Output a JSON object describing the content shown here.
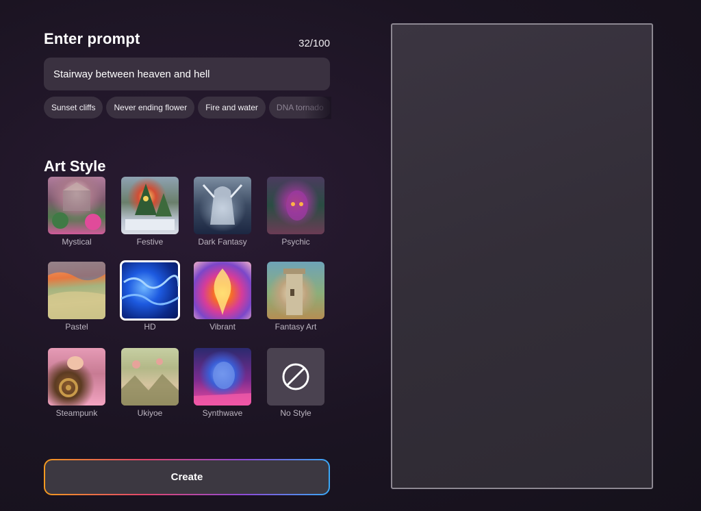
{
  "prompt": {
    "title": "Enter prompt",
    "counter": "32/100",
    "value": "Stairway between heaven and hell"
  },
  "suggestions": [
    "Sunset cliffs",
    "Never ending flower",
    "Fire and water",
    "DNA tornado"
  ],
  "art_style": {
    "title": "Art Style",
    "selected": "HD",
    "styles": [
      {
        "label": "Mystical",
        "icon": "art-thumbnail"
      },
      {
        "label": "Festive",
        "icon": "art-thumbnail"
      },
      {
        "label": "Dark Fantasy",
        "icon": "art-thumbnail"
      },
      {
        "label": "Psychic",
        "icon": "art-thumbnail"
      },
      {
        "label": "Pastel",
        "icon": "art-thumbnail"
      },
      {
        "label": "HD",
        "icon": "art-thumbnail"
      },
      {
        "label": "Vibrant",
        "icon": "art-thumbnail"
      },
      {
        "label": "Fantasy Art",
        "icon": "art-thumbnail"
      },
      {
        "label": "Steampunk",
        "icon": "art-thumbnail"
      },
      {
        "label": "Ukiyoe",
        "icon": "art-thumbnail"
      },
      {
        "label": "Synthwave",
        "icon": "art-thumbnail"
      },
      {
        "label": "No Style",
        "icon": "no-style-icon"
      }
    ]
  },
  "create_button": {
    "label": "Create"
  },
  "colors": {
    "background": "#1b1422",
    "field": "#3a3140",
    "selected_border": "#ffffff",
    "button_gradient": [
      "#f39a1f",
      "#e2466c",
      "#8e4bd8",
      "#3aa8f5"
    ]
  }
}
